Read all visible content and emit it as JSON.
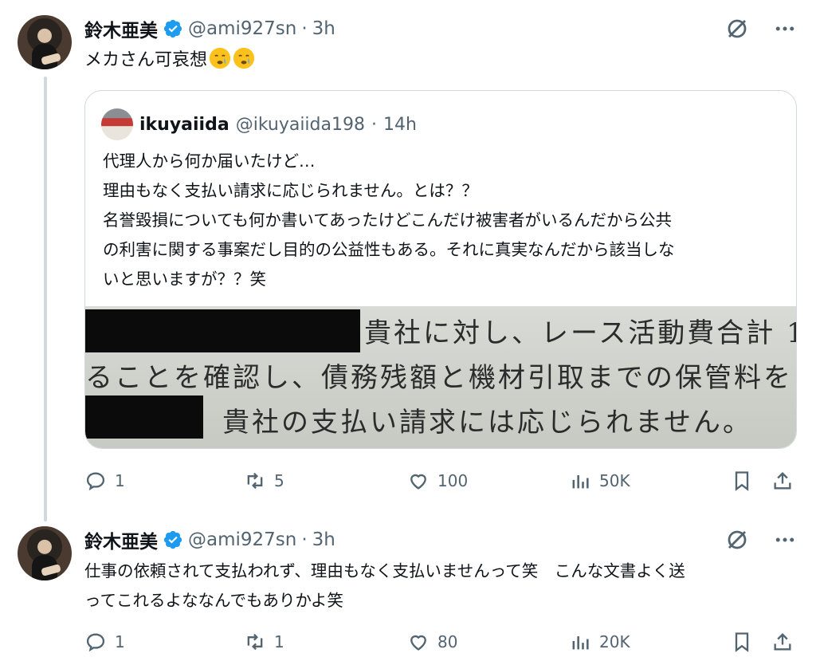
{
  "posts": [
    {
      "author_name": "鈴木亜美",
      "handle": "@ami927sn",
      "separator": "·",
      "time": "3h",
      "text": "メカさん可哀想",
      "emoji": [
        "face-holding-back-tears",
        "face-holding-back-tears"
      ],
      "quote": {
        "author_name": "ikuyaiida",
        "handle": "@ikuyaiida198",
        "separator": "·",
        "time": "14h",
        "lines": [
          "代理人から何か届いたけど…",
          "理由もなく支払い請求に応じられません。とは？？",
          "名誉毀損についても何か書いてあったけどこんだけ被害者がいるんだから公共",
          "の利害に関する事案だし目的の公益性もある。それに真実なんだから該当しな",
          "いと思いますが？？笑"
        ],
        "document_lines": [
          "貴社に対し、レース活動費合計 1",
          "ることを確認し、債務残額と機材引取までの保管料を",
          "貴社の支払い請求には応じられません。"
        ]
      },
      "actions": {
        "replies": "1",
        "reposts": "5",
        "likes": "100",
        "views": "50K"
      }
    },
    {
      "author_name": "鈴木亜美",
      "handle": "@ami927sn",
      "separator": "·",
      "time": "3h",
      "lines": [
        "仕事の依頼されて支払われず、理由もなく支払いませんって笑　こんな文書よく送",
        "ってこれるよななんでもありかよ笑"
      ],
      "actions": {
        "replies": "1",
        "reposts": "1",
        "likes": "80",
        "views": "20K"
      }
    }
  ],
  "colors": {
    "text": "#0f1419",
    "secondary": "#536471",
    "verified": "#1d9bf0",
    "border": "#cfd9de"
  }
}
